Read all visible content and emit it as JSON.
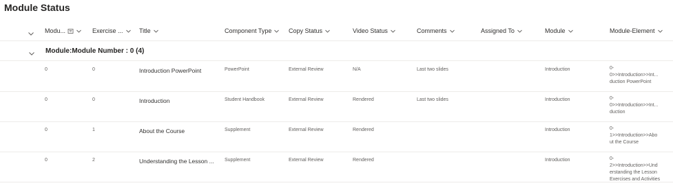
{
  "page": {
    "title": "Module Status"
  },
  "columns": [
    {
      "label": "Modu...",
      "filtered": true
    },
    {
      "label": "Exercise ..."
    },
    {
      "label": "Title"
    },
    {
      "label": "Component Type"
    },
    {
      "label": "Copy Status"
    },
    {
      "label": "Video Status"
    },
    {
      "label": "Comments"
    },
    {
      "label": "Assigned To"
    },
    {
      "label": "Module"
    },
    {
      "label": "Module-Element"
    }
  ],
  "group": {
    "label": "Module:Module Number : 0 (4)"
  },
  "rows": [
    {
      "module_number": "0",
      "exercise": "0",
      "title": "Introduction PowerPoint",
      "component_type": "PowerPoint",
      "copy_status": "External Review",
      "video_status": "N/A",
      "comments": "Last two slides",
      "assigned_to": "",
      "module": "Introduction",
      "module_element": "0-0>>Introduction>>Introduction PowerPoint",
      "module_element_lines": [
        "0-",
        "0>>Introduction>>Int...",
        "duction PowerPoint"
      ]
    },
    {
      "module_number": "0",
      "exercise": "0",
      "title": "Introduction",
      "component_type": "Student Handbook",
      "copy_status": "External Review",
      "video_status": "Rendered",
      "comments": "Last two slides",
      "assigned_to": "",
      "module": "Introduction",
      "module_element": "0-0>>Introduction>>Introduction",
      "module_element_lines": [
        "0-",
        "0>>Introduction>>Int...",
        "duction"
      ]
    },
    {
      "module_number": "0",
      "exercise": "1",
      "title": "About the Course",
      "component_type": "Supplement",
      "copy_status": "External Review",
      "video_status": "Rendered",
      "comments": "",
      "assigned_to": "",
      "module": "Introduction",
      "module_element": "0-1>>Introduction>>About the Course",
      "module_element_lines": [
        "0-",
        "1>>Introduction>>Abo",
        "ut the Course"
      ]
    },
    {
      "module_number": "0",
      "exercise": "2",
      "title": "Understanding the Lesson ...",
      "component_type": "Supplement",
      "copy_status": "External Review",
      "video_status": "Rendered",
      "comments": "",
      "assigned_to": "",
      "module": "Introduction",
      "module_element": "0-2>>Introduction>>Understanding the Lesson Exercises and Activities",
      "module_element_lines": [
        "0-",
        "2>>Introduction>>Und",
        "erstanding the Lesson",
        "Exercises and Activities"
      ]
    }
  ]
}
